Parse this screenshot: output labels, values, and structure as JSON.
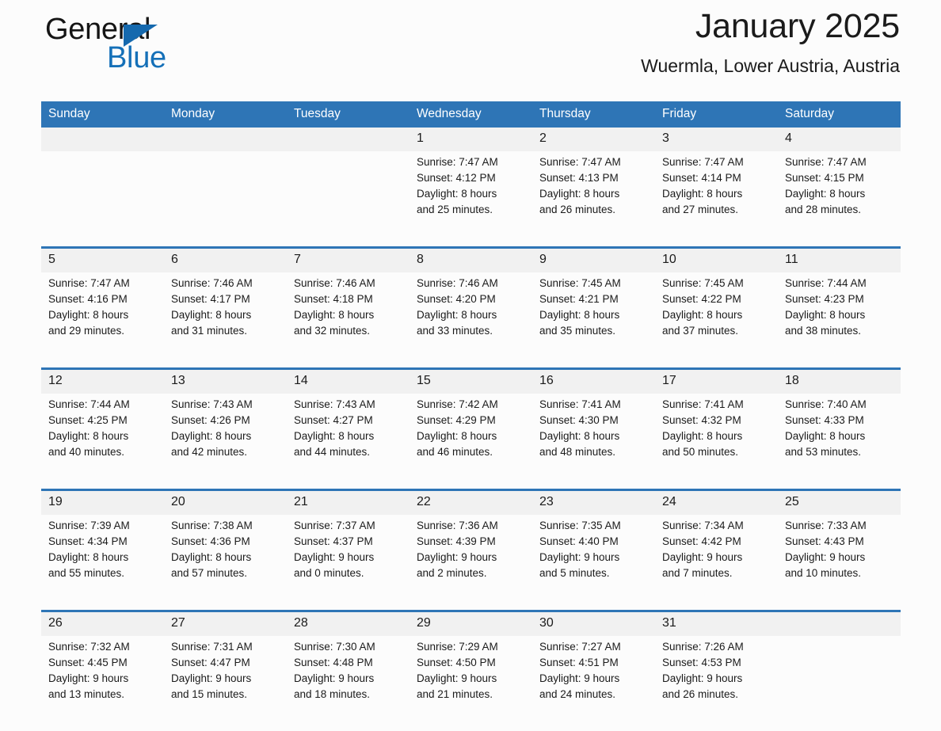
{
  "brand": {
    "name_top": "General",
    "name_bottom": "Blue",
    "accent_color": "#1570b8"
  },
  "header": {
    "title": "January 2025",
    "location": "Wuermla, Lower Austria, Austria"
  },
  "calendar": {
    "header_bg": "#2e75b6",
    "daynum_bg": "#f1f1f1",
    "weekday_labels": [
      "Sunday",
      "Monday",
      "Tuesday",
      "Wednesday",
      "Thursday",
      "Friday",
      "Saturday"
    ],
    "weeks": [
      [
        {
          "day": "",
          "lines": []
        },
        {
          "day": "",
          "lines": []
        },
        {
          "day": "",
          "lines": []
        },
        {
          "day": "1",
          "lines": [
            "Sunrise: 7:47 AM",
            "Sunset: 4:12 PM",
            "Daylight: 8 hours",
            "and 25 minutes."
          ]
        },
        {
          "day": "2",
          "lines": [
            "Sunrise: 7:47 AM",
            "Sunset: 4:13 PM",
            "Daylight: 8 hours",
            "and 26 minutes."
          ]
        },
        {
          "day": "3",
          "lines": [
            "Sunrise: 7:47 AM",
            "Sunset: 4:14 PM",
            "Daylight: 8 hours",
            "and 27 minutes."
          ]
        },
        {
          "day": "4",
          "lines": [
            "Sunrise: 7:47 AM",
            "Sunset: 4:15 PM",
            "Daylight: 8 hours",
            "and 28 minutes."
          ]
        }
      ],
      [
        {
          "day": "5",
          "lines": [
            "Sunrise: 7:47 AM",
            "Sunset: 4:16 PM",
            "Daylight: 8 hours",
            "and 29 minutes."
          ]
        },
        {
          "day": "6",
          "lines": [
            "Sunrise: 7:46 AM",
            "Sunset: 4:17 PM",
            "Daylight: 8 hours",
            "and 31 minutes."
          ]
        },
        {
          "day": "7",
          "lines": [
            "Sunrise: 7:46 AM",
            "Sunset: 4:18 PM",
            "Daylight: 8 hours",
            "and 32 minutes."
          ]
        },
        {
          "day": "8",
          "lines": [
            "Sunrise: 7:46 AM",
            "Sunset: 4:20 PM",
            "Daylight: 8 hours",
            "and 33 minutes."
          ]
        },
        {
          "day": "9",
          "lines": [
            "Sunrise: 7:45 AM",
            "Sunset: 4:21 PM",
            "Daylight: 8 hours",
            "and 35 minutes."
          ]
        },
        {
          "day": "10",
          "lines": [
            "Sunrise: 7:45 AM",
            "Sunset: 4:22 PM",
            "Daylight: 8 hours",
            "and 37 minutes."
          ]
        },
        {
          "day": "11",
          "lines": [
            "Sunrise: 7:44 AM",
            "Sunset: 4:23 PM",
            "Daylight: 8 hours",
            "and 38 minutes."
          ]
        }
      ],
      [
        {
          "day": "12",
          "lines": [
            "Sunrise: 7:44 AM",
            "Sunset: 4:25 PM",
            "Daylight: 8 hours",
            "and 40 minutes."
          ]
        },
        {
          "day": "13",
          "lines": [
            "Sunrise: 7:43 AM",
            "Sunset: 4:26 PM",
            "Daylight: 8 hours",
            "and 42 minutes."
          ]
        },
        {
          "day": "14",
          "lines": [
            "Sunrise: 7:43 AM",
            "Sunset: 4:27 PM",
            "Daylight: 8 hours",
            "and 44 minutes."
          ]
        },
        {
          "day": "15",
          "lines": [
            "Sunrise: 7:42 AM",
            "Sunset: 4:29 PM",
            "Daylight: 8 hours",
            "and 46 minutes."
          ]
        },
        {
          "day": "16",
          "lines": [
            "Sunrise: 7:41 AM",
            "Sunset: 4:30 PM",
            "Daylight: 8 hours",
            "and 48 minutes."
          ]
        },
        {
          "day": "17",
          "lines": [
            "Sunrise: 7:41 AM",
            "Sunset: 4:32 PM",
            "Daylight: 8 hours",
            "and 50 minutes."
          ]
        },
        {
          "day": "18",
          "lines": [
            "Sunrise: 7:40 AM",
            "Sunset: 4:33 PM",
            "Daylight: 8 hours",
            "and 53 minutes."
          ]
        }
      ],
      [
        {
          "day": "19",
          "lines": [
            "Sunrise: 7:39 AM",
            "Sunset: 4:34 PM",
            "Daylight: 8 hours",
            "and 55 minutes."
          ]
        },
        {
          "day": "20",
          "lines": [
            "Sunrise: 7:38 AM",
            "Sunset: 4:36 PM",
            "Daylight: 8 hours",
            "and 57 minutes."
          ]
        },
        {
          "day": "21",
          "lines": [
            "Sunrise: 7:37 AM",
            "Sunset: 4:37 PM",
            "Daylight: 9 hours",
            "and 0 minutes."
          ]
        },
        {
          "day": "22",
          "lines": [
            "Sunrise: 7:36 AM",
            "Sunset: 4:39 PM",
            "Daylight: 9 hours",
            "and 2 minutes."
          ]
        },
        {
          "day": "23",
          "lines": [
            "Sunrise: 7:35 AM",
            "Sunset: 4:40 PM",
            "Daylight: 9 hours",
            "and 5 minutes."
          ]
        },
        {
          "day": "24",
          "lines": [
            "Sunrise: 7:34 AM",
            "Sunset: 4:42 PM",
            "Daylight: 9 hours",
            "and 7 minutes."
          ]
        },
        {
          "day": "25",
          "lines": [
            "Sunrise: 7:33 AM",
            "Sunset: 4:43 PM",
            "Daylight: 9 hours",
            "and 10 minutes."
          ]
        }
      ],
      [
        {
          "day": "26",
          "lines": [
            "Sunrise: 7:32 AM",
            "Sunset: 4:45 PM",
            "Daylight: 9 hours",
            "and 13 minutes."
          ]
        },
        {
          "day": "27",
          "lines": [
            "Sunrise: 7:31 AM",
            "Sunset: 4:47 PM",
            "Daylight: 9 hours",
            "and 15 minutes."
          ]
        },
        {
          "day": "28",
          "lines": [
            "Sunrise: 7:30 AM",
            "Sunset: 4:48 PM",
            "Daylight: 9 hours",
            "and 18 minutes."
          ]
        },
        {
          "day": "29",
          "lines": [
            "Sunrise: 7:29 AM",
            "Sunset: 4:50 PM",
            "Daylight: 9 hours",
            "and 21 minutes."
          ]
        },
        {
          "day": "30",
          "lines": [
            "Sunrise: 7:27 AM",
            "Sunset: 4:51 PM",
            "Daylight: 9 hours",
            "and 24 minutes."
          ]
        },
        {
          "day": "31",
          "lines": [
            "Sunrise: 7:26 AM",
            "Sunset: 4:53 PM",
            "Daylight: 9 hours",
            "and 26 minutes."
          ]
        },
        {
          "day": "",
          "lines": []
        }
      ]
    ]
  }
}
